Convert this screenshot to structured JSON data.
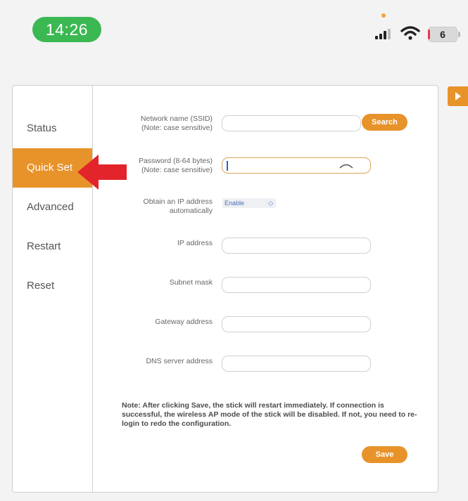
{
  "status_bar": {
    "time": "14:26",
    "battery": "6"
  },
  "sidebar": {
    "items": [
      {
        "label": "Status"
      },
      {
        "label": "Quick Set"
      },
      {
        "label": "Advanced"
      },
      {
        "label": "Restart"
      },
      {
        "label": "Reset"
      }
    ],
    "active_index": 1
  },
  "form": {
    "ssid": {
      "label_1": "Network name (SSID)",
      "label_2": "(Note: case sensitive)",
      "value": ""
    },
    "search_label": "Search",
    "password": {
      "label_1": "Password (8-64 bytes)",
      "label_2": "(Note: case sensitive)",
      "value": ""
    },
    "obtain_ip": {
      "label_1": "Obtain an IP address",
      "label_2": "automatically",
      "selected": "Enable"
    },
    "ip_address": {
      "label": "IP address",
      "value": ""
    },
    "subnet_mask": {
      "label": "Subnet mask",
      "value": ""
    },
    "gateway": {
      "label": "Gateway address",
      "value": ""
    },
    "dns": {
      "label": "DNS server address",
      "value": ""
    },
    "note": "Note: After clicking Save, the stick will restart immediately. If connection is successful, the wireless AP mode of the stick will be disabled. If not, you need to re-login to redo the configuration.",
    "save_label": "Save"
  },
  "colors": {
    "accent": "#e8932a",
    "time_pill": "#3cb853",
    "arrow": "#e3242b"
  }
}
